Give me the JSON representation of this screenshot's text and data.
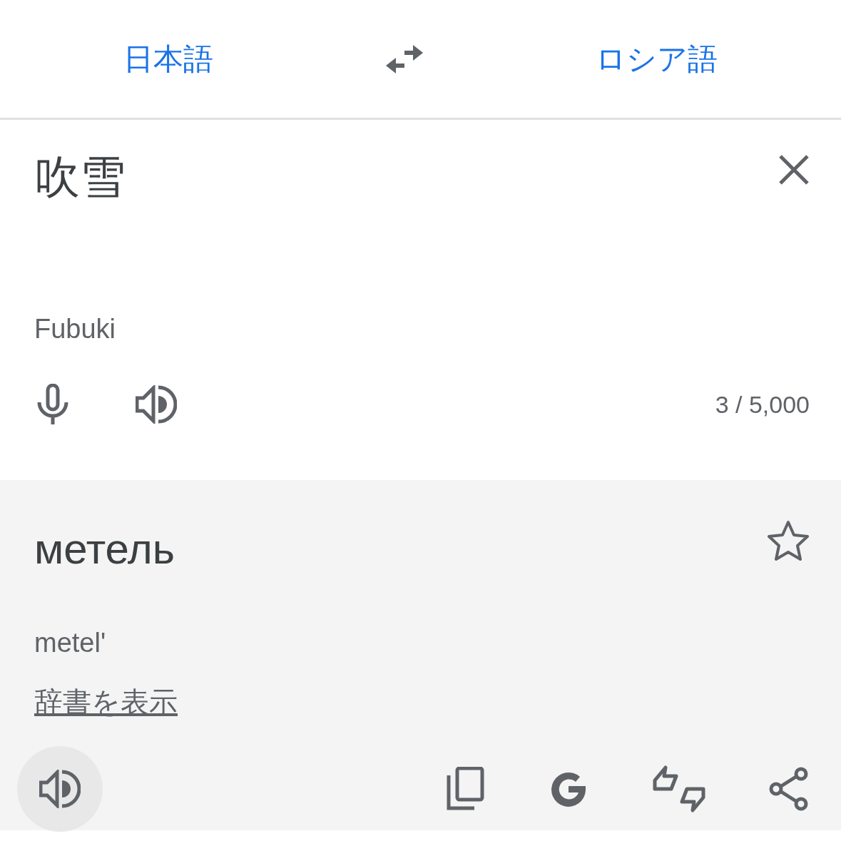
{
  "languages": {
    "source": "日本語",
    "target": "ロシア語"
  },
  "input": {
    "text": "吹雪",
    "romanization": "Fubuki",
    "char_count": "3 / 5,000"
  },
  "result": {
    "text": "метель",
    "romanization": "metel'",
    "dictionary_link": "辞書を表示",
    "starred": false
  }
}
